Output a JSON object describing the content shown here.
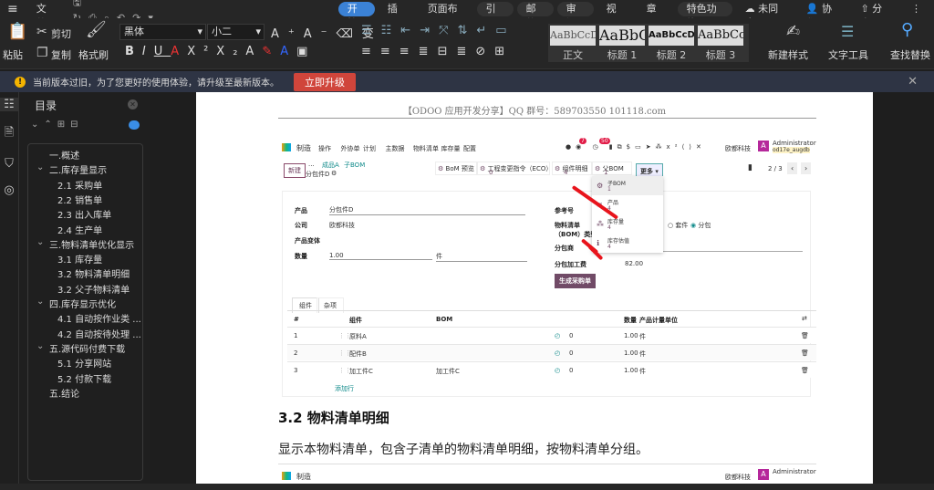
{
  "menubar": {
    "file": "文件",
    "tabs": [
      "开始",
      "插入",
      "页面布局",
      "引用",
      "邮件",
      "审阅",
      "视图",
      "章节",
      "特色功能"
    ],
    "sync": "未同步",
    "collab": "协作",
    "share": "分享"
  },
  "ribbon": {
    "paste": "粘贴",
    "cut": "剪切",
    "copy": "复制",
    "format_painter": "格式刷",
    "font": "黑体",
    "size": "小二",
    "styles": [
      {
        "sample": "AaBbCcDd",
        "label": "正文"
      },
      {
        "sample": "AaBbC",
        "label": "标题 1"
      },
      {
        "sample": "AaBbCcDd",
        "label": "标题 2"
      },
      {
        "sample": "AaBbCcD",
        "label": "标题 3"
      }
    ],
    "new_style": "新建样式",
    "text_tools": "文字工具",
    "find_replace": "查找替换"
  },
  "notice": {
    "text": "当前版本过旧，为了您更好的使用体验，请升级至最新版本。",
    "button": "立即升级"
  },
  "toc": {
    "title": "目录",
    "items": [
      {
        "label": "一.概述",
        "level": 1,
        "caret": false
      },
      {
        "label": "二.库存量显示",
        "level": 1,
        "caret": true
      },
      {
        "label": "2.1 采购单",
        "level": 2
      },
      {
        "label": "2.2 销售单",
        "level": 2
      },
      {
        "label": "2.3 出入库单",
        "level": 2
      },
      {
        "label": "2.4 生产单",
        "level": 2
      },
      {
        "label": "三.物料清单优化显示",
        "level": 1,
        "caret": true
      },
      {
        "label": "3.1 库存量",
        "level": 2
      },
      {
        "label": "3.2 物料清单明细",
        "level": 2
      },
      {
        "label": "3.2 父子物料清单",
        "level": 2
      },
      {
        "label": "四.库存显示优化",
        "level": 1,
        "caret": true
      },
      {
        "label": "4.1 自动按作业类 ...",
        "level": 2
      },
      {
        "label": "4.2 自动按待处理 ...",
        "level": 2
      },
      {
        "label": "五.源代码付费下载",
        "level": 1,
        "caret": true
      },
      {
        "label": "5.1 分享网站",
        "level": 2
      },
      {
        "label": "5.2 付款下载",
        "level": 2
      },
      {
        "label": "五.结论",
        "level": 1,
        "caret": false
      }
    ]
  },
  "doc": {
    "header": "【ODOO 应用开发分享】QQ 群号：589703550 101118.com",
    "heading": "3.2 物料清单明细",
    "paragraph": "显示本物料清单，包含子清单的物料清单明细，按物料清单分组。"
  },
  "odoo": {
    "app": "制造",
    "nav": [
      "操作",
      "外协单",
      "计划",
      "主数据",
      "物料清单",
      "库存量",
      "配置"
    ],
    "badge1": "7",
    "badge2": "50",
    "company": "欧都科技",
    "user": "Administrator",
    "db": "od17e_augdb",
    "avatar": "A",
    "new": "新建",
    "breadcrumb": [
      "...",
      "成品A",
      "子BOM"
    ],
    "record": "分包件D",
    "smart": [
      {
        "label": "BoM 预览",
        "count": ""
      },
      {
        "label": "工程变更指令（ECO）",
        "count": "0"
      },
      {
        "label": "组件明细",
        "count": "4"
      },
      {
        "label": "父BOM",
        "count": "1"
      }
    ],
    "more": "更多",
    "pager": "2 / 3",
    "dropdown": [
      {
        "label": "子BOM",
        "count": "1"
      },
      {
        "label": "产品",
        "count": "4"
      },
      {
        "label": "库存量",
        "count": "4"
      },
      {
        "label": "库存估值",
        "count": "4"
      }
    ],
    "fields": {
      "product_l": "产品",
      "product": "分包件D",
      "company_l": "公司",
      "company": "欧都科技",
      "variant_l": "产品变体",
      "qty_l": "数量",
      "qty": "1.00",
      "uom": "件",
      "ref_l": "参考号",
      "bomtype_l": "物料清单（BOM）类型",
      "kit": "套件",
      "sub": "分包",
      "subcontractor_l": "分包商",
      "fee_l": "分包加工费",
      "fee": "82.00",
      "po_button": "生成采购单"
    },
    "tabs": [
      "组件",
      "杂项"
    ],
    "cols": [
      "#",
      "组件",
      "BOM",
      "数量",
      "产品计量单位"
    ],
    "rows": [
      {
        "n": "1",
        "comp": "原料A",
        "bom": "",
        "fc": "0",
        "qty": "1.00",
        "uom": "件"
      },
      {
        "n": "2",
        "comp": "配件B",
        "bom": "",
        "fc": "0",
        "qty": "1.00",
        "uom": "件"
      },
      {
        "n": "3",
        "comp": "加工件C",
        "bom": "加工件C",
        "fc": "0",
        "qty": "1.00",
        "uom": "件"
      }
    ],
    "add_line": "添加行"
  }
}
